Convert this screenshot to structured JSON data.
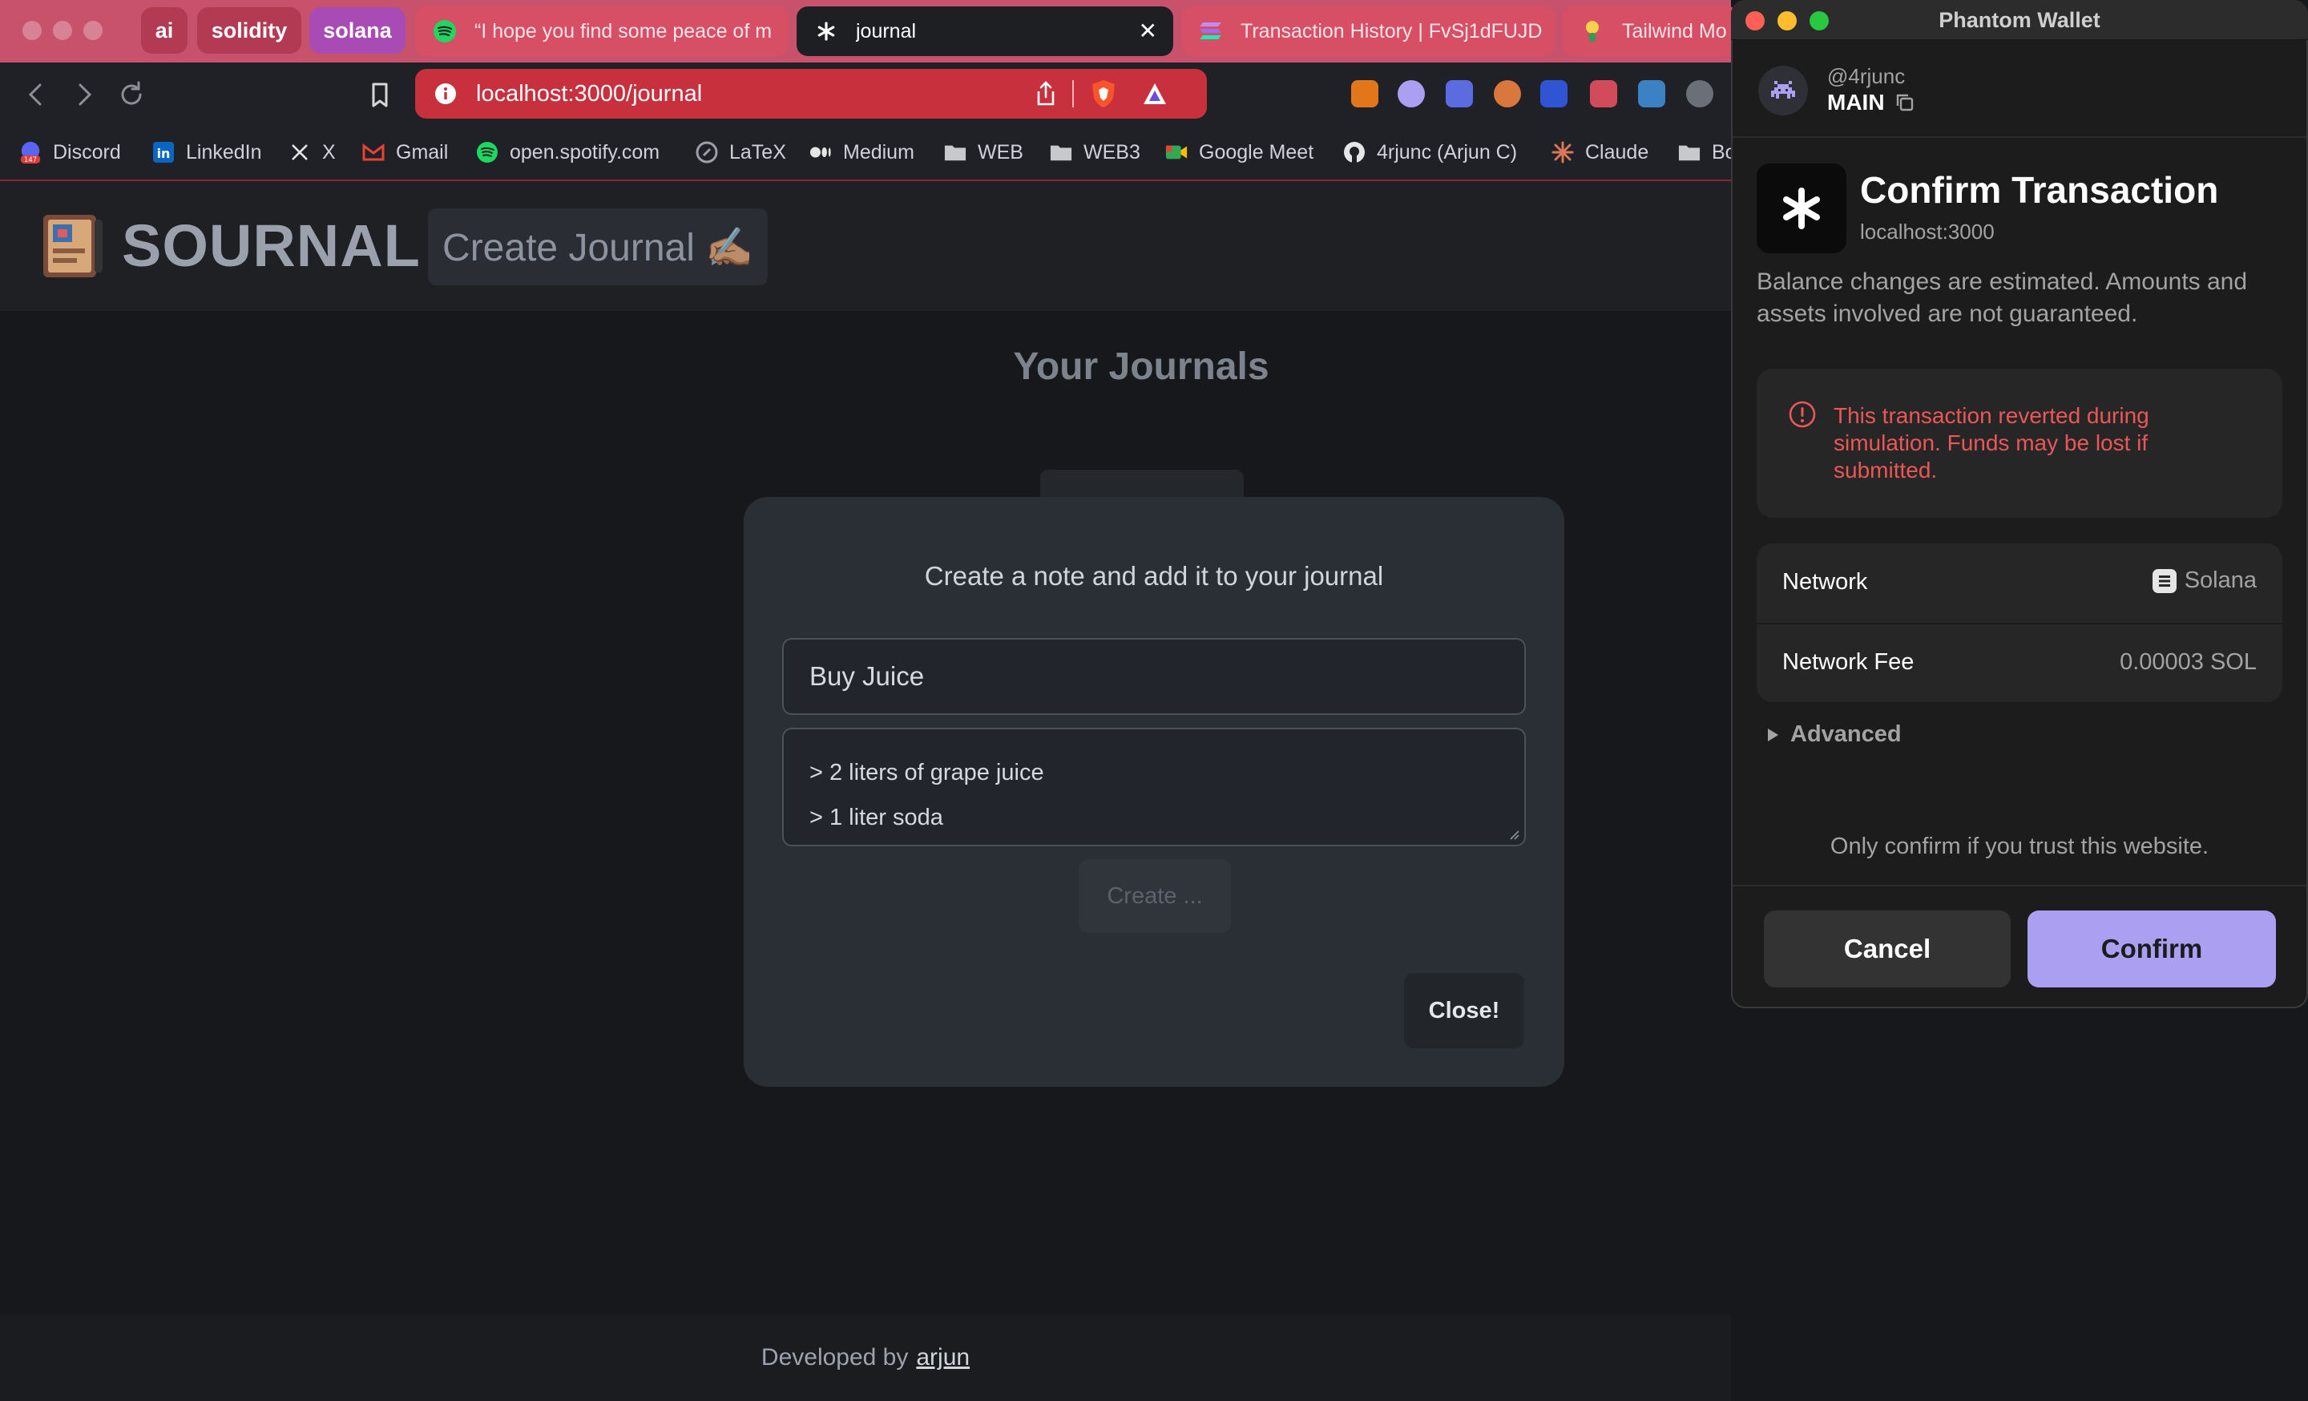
{
  "browser": {
    "tab_groups": [
      {
        "label": "ai",
        "color": "#b23a52"
      },
      {
        "label": "solidity",
        "color": "#b23a52"
      },
      {
        "label": "solana",
        "color": "#a94bb4"
      }
    ],
    "tabs": [
      {
        "title": "“I hope you find some peace of m",
        "icon": "spotify-icon"
      },
      {
        "title": "journal",
        "icon": "asterisk-icon",
        "active": true
      },
      {
        "title": "Transaction History | FvSj1dFUJD",
        "icon": "solana-icon"
      },
      {
        "title": "Tailwind Mo",
        "icon": "tailwind-icon"
      }
    ],
    "close_tab_glyph": "✕",
    "url": "localhost:3000/journal",
    "bookmarks": [
      {
        "label": "Discord",
        "icon": "discord-icon",
        "badge": "147"
      },
      {
        "label": "LinkedIn",
        "icon": "linkedin-icon"
      },
      {
        "label": "X",
        "icon": "x-icon"
      },
      {
        "label": "Gmail",
        "icon": "gmail-icon"
      },
      {
        "label": "open.spotify.com",
        "icon": "spotify-icon"
      },
      {
        "label": "LaTeX",
        "icon": "latex-icon"
      },
      {
        "label": "Medium",
        "icon": "medium-icon"
      },
      {
        "label": "WEB",
        "icon": "folder-icon"
      },
      {
        "label": "WEB3",
        "icon": "folder-icon"
      },
      {
        "label": "Google Meet",
        "icon": "google-meet-icon"
      },
      {
        "label": "4rjunc (Arjun C)",
        "icon": "github-icon"
      },
      {
        "label": "Claude",
        "icon": "claude-icon"
      },
      {
        "label": "Bo",
        "icon": "folder-icon"
      }
    ]
  },
  "app": {
    "brand": "SOURNAL",
    "create_journal_label": "Create Journal ✍🏽",
    "page_title": "Your Journals",
    "footer_prefix": "Developed by",
    "footer_link": "arjun"
  },
  "modal": {
    "title": "Create a note and add it to your journal",
    "note_title_value": "Buy Juice",
    "note_body_lines": [
      "> 2 liters of grape juice",
      "> 1 liter soda"
    ],
    "create_label": "Create ...",
    "close_label": "Close!"
  },
  "phantom": {
    "window_title": "Phantom Wallet",
    "handle": "@4rjunc",
    "account": "MAIN",
    "heading": "Confirm Transaction",
    "origin": "localhost:3000",
    "disclaimer": "Balance changes are estimated. Amounts and assets involved are not guaranteed.",
    "warning": "This transaction reverted during simulation. Funds may be lost if submitted.",
    "details": [
      {
        "label": "Network",
        "value": "Solana"
      },
      {
        "label": "Network Fee",
        "value": "0.00003 SOL"
      }
    ],
    "advanced_label": "Advanced",
    "trust_note": "Only confirm if you trust this website.",
    "cancel_label": "Cancel",
    "confirm_label": "Confirm",
    "colors": {
      "accent": "#ab9ff2",
      "danger": "#eb5757"
    }
  }
}
